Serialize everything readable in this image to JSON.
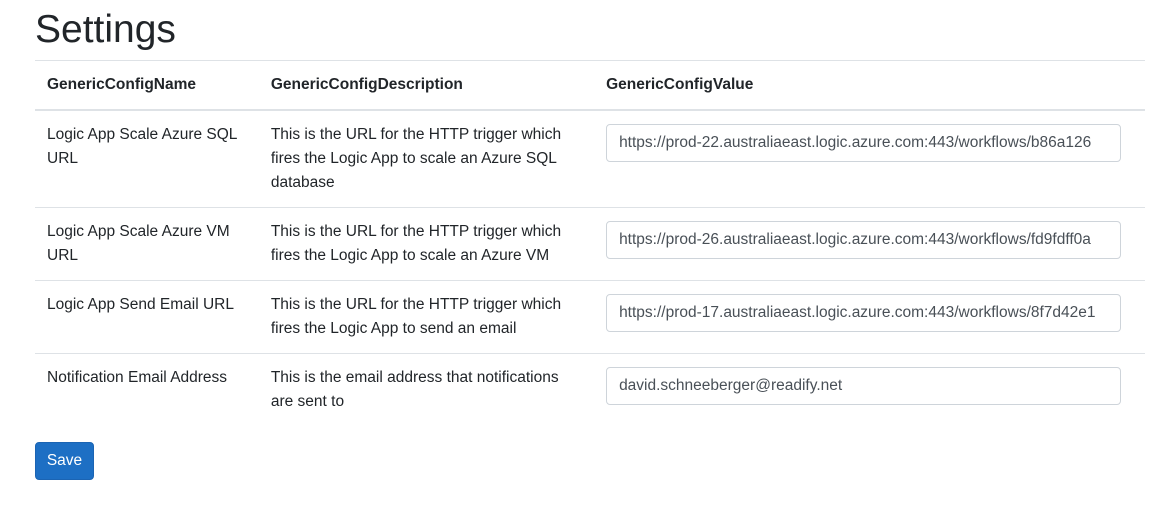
{
  "page": {
    "title": "Settings"
  },
  "table": {
    "headers": {
      "name": "GenericConfigName",
      "description": "GenericConfigDescription",
      "value": "GenericConfigValue"
    },
    "rows": [
      {
        "name": "Logic App Scale Azure SQL URL",
        "description": "This is the URL for the HTTP trigger which fires the Logic App to scale an Azure SQL database",
        "value": "https://prod-22.australiaeast.logic.azure.com:443/workflows/b86a126"
      },
      {
        "name": "Logic App Scale Azure VM URL",
        "description": "This is the URL for the HTTP trigger which fires the Logic App to scale an Azure VM",
        "value": "https://prod-26.australiaeast.logic.azure.com:443/workflows/fd9fdff0a"
      },
      {
        "name": "Logic App Send Email URL",
        "description": "This is the URL for the HTTP trigger which fires the Logic App to send an email",
        "value": "https://prod-17.australiaeast.logic.azure.com:443/workflows/8f7d42e1"
      },
      {
        "name": "Notification Email Address",
        "description": "This is the email address that notifications are sent to",
        "value": "david.schneeberger@readify.net"
      }
    ]
  },
  "actions": {
    "save_label": "Save"
  },
  "colors": {
    "primary_button": "#1d6fc4",
    "border": "#dee2e6",
    "input_border": "#ced4da"
  }
}
